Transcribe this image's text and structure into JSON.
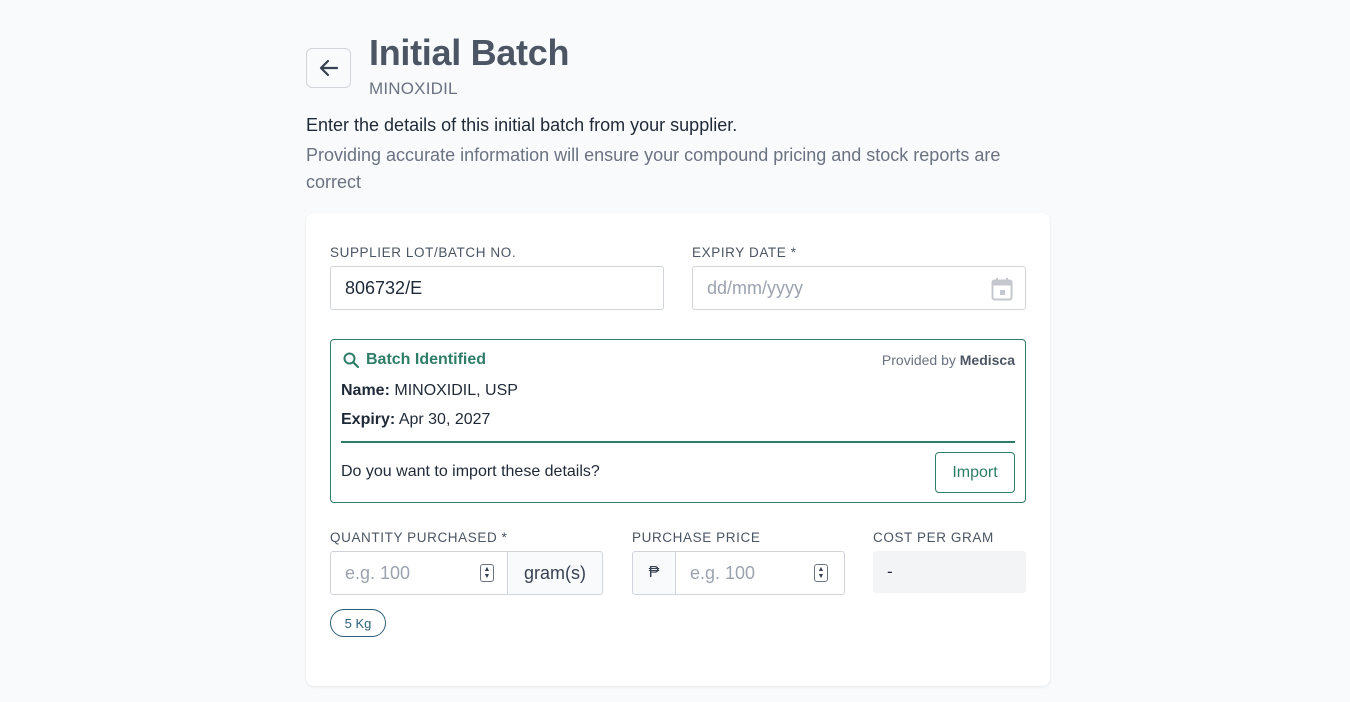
{
  "header": {
    "title": "Initial Batch",
    "subtitle": "MINOXIDIL",
    "intro": "Enter the details of this initial batch from your supplier.",
    "intro_sub": "Providing accurate information will ensure your compound pricing and stock reports are correct"
  },
  "form": {
    "lot_label": "SUPPLIER LOT/BATCH NO.",
    "lot_value": "806732/E",
    "expiry_label": "EXPIRY DATE *",
    "expiry_placeholder": "dd/mm/yyyy",
    "quantity_label": "QUANTITY PURCHASED *",
    "quantity_placeholder": "e.g. 100",
    "quantity_unit": "gram(s)",
    "price_label": "PURCHASE PRICE",
    "price_currency": "₱",
    "price_placeholder": "e.g. 100",
    "cost_label": "COST PER GRAM",
    "cost_value": "-",
    "chip": "5 Kg"
  },
  "batch": {
    "heading": "Batch Identified",
    "provided_by": "Provided by",
    "provider": "Medisca",
    "name_label": "Name:",
    "name_value": "MINOXIDIL, USP",
    "expiry_label": "Expiry:",
    "expiry_value": "Apr 30, 2027",
    "question": "Do you want to import these details?",
    "import_label": "Import"
  },
  "colors": {
    "accent": "#2e7d68",
    "chip": "#2e5f7a",
    "background": "#f8fafc"
  },
  "icons": [
    "arrow-left-icon",
    "calendar-icon",
    "search-icon",
    "stepper-icon"
  ]
}
